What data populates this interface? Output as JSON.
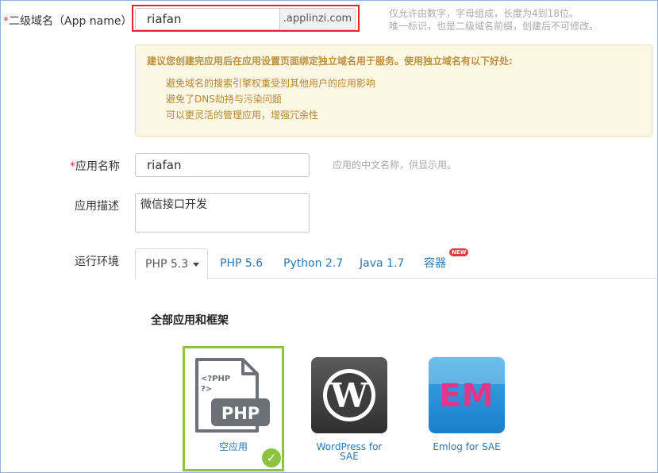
{
  "form": {
    "app_name_label": "二级域名（App name）",
    "app_name_value": "riafan",
    "app_name_suffix": ".applinzi.com",
    "app_name_hint_1": "仅允许由数字，字母组成，长度为4到18位。",
    "app_name_hint_2": "唯一标识，也是二级域名前缀，创建后不可修改。",
    "required_mark": "*",
    "notice": {
      "title": "建议您创建完应用后在应用设置页面绑定独立域名用于服务。使用独立域名有以下好处:",
      "items": [
        "避免域名的搜索引擎权重受到其他用户的应用影响",
        "避免了DNS劫持与污染问题",
        "可以更灵活的管理应用，增强冗余性"
      ]
    },
    "display_name_label": "应用名称",
    "display_name_value": "riafan",
    "display_name_hint": "应用的中文名称，供显示用。",
    "description_label": "应用描述",
    "description_value": "微信接口开发",
    "runtime_label": "运行环境"
  },
  "runtime_tabs": [
    {
      "label": "PHP 5.3",
      "active": true
    },
    {
      "label": "PHP 5.6"
    },
    {
      "label": "Python 2.7"
    },
    {
      "label": "Java 1.7"
    },
    {
      "label": "容器",
      "badge": "NEW"
    }
  ],
  "apps_section": {
    "title": "全部应用和框架",
    "apps": [
      {
        "name": "空应用",
        "icon": "php-file-icon",
        "selected": true,
        "icon_text_top": "<?PHP\n?>",
        "icon_text_main": "PHP"
      },
      {
        "name_line1": "WordPress for",
        "name_line2": "SAE",
        "icon": "wordpress-logo-icon"
      },
      {
        "name": "Emlog for SAE",
        "icon": "emlog-logo-icon",
        "logo_text": "EM"
      }
    ]
  },
  "colors": {
    "accent_link": "#2a77b3",
    "selected_green": "#8bc53f",
    "highlight_red": "#e8232b",
    "notice_bg": "#fcf8e3"
  }
}
